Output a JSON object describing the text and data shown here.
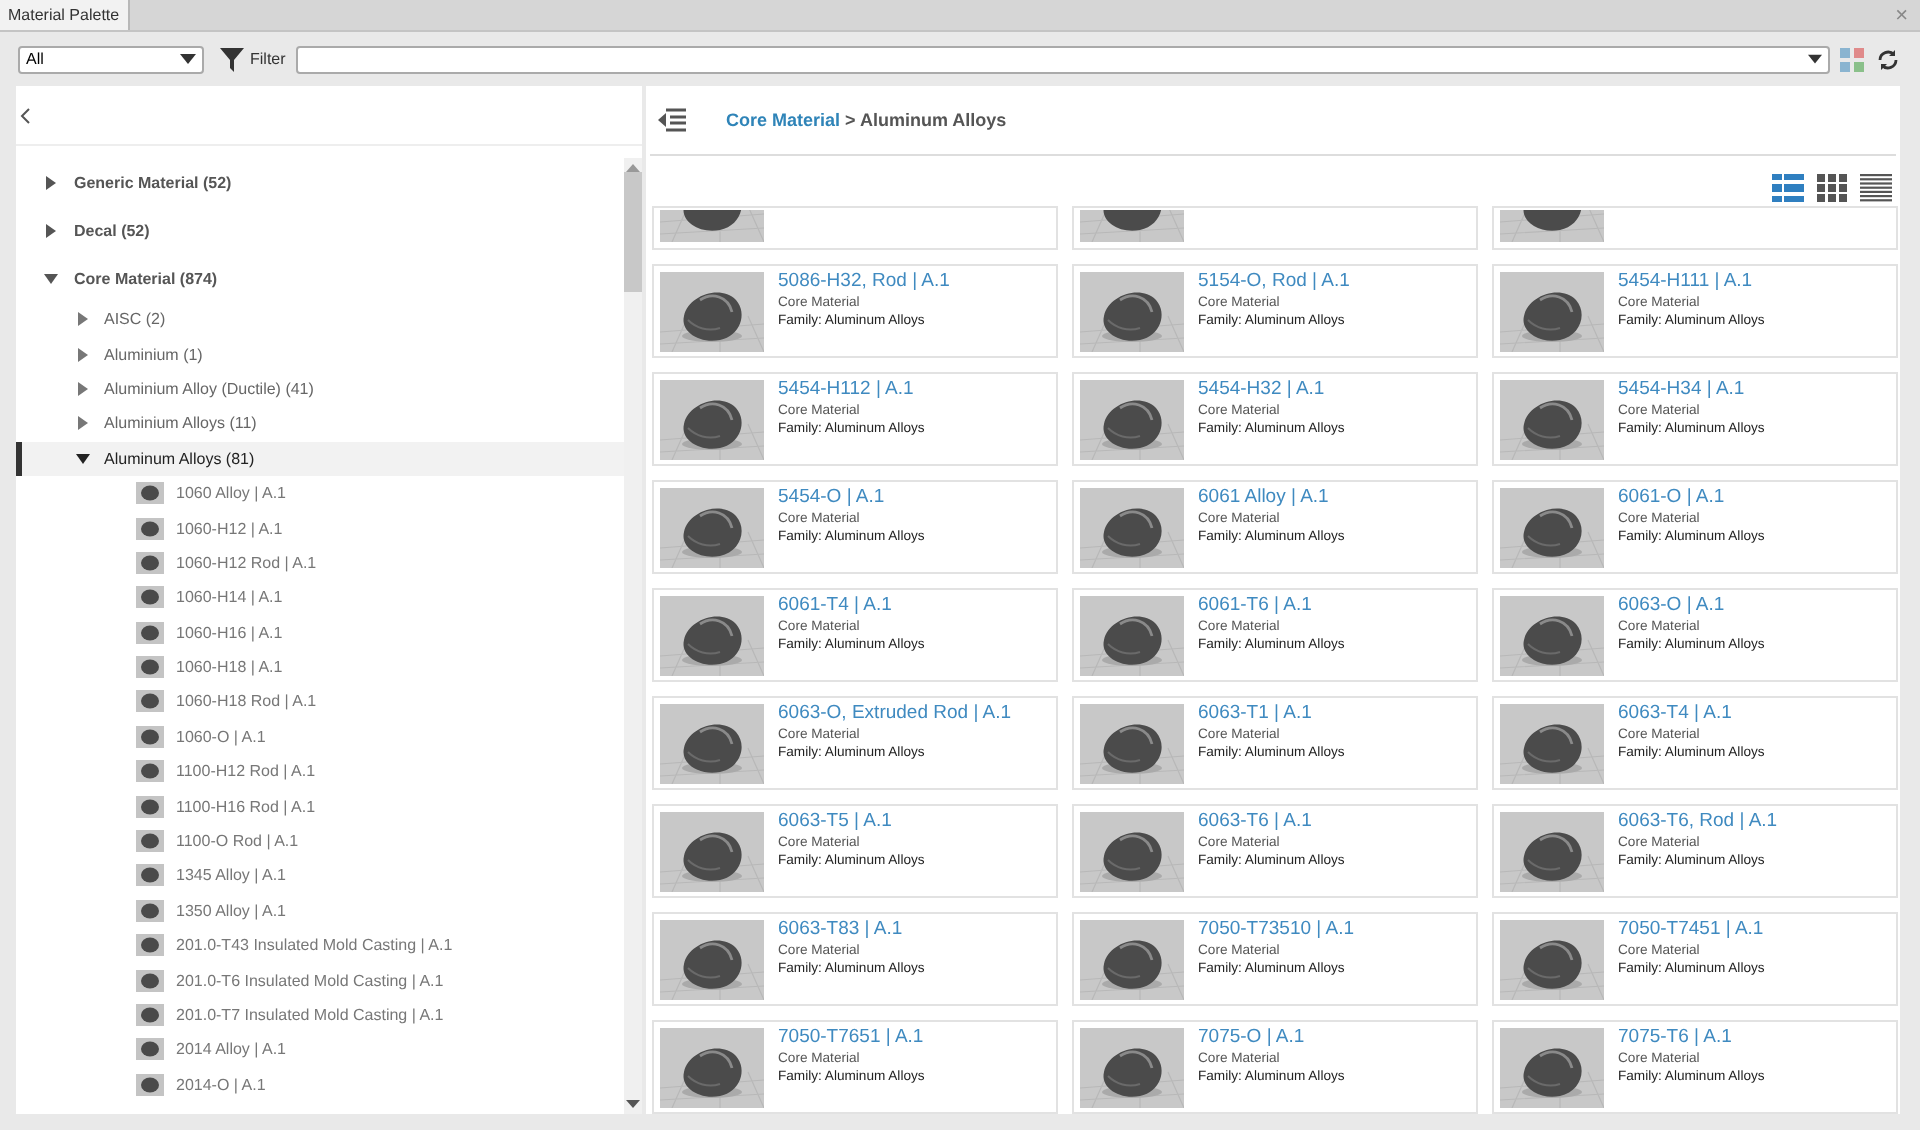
{
  "window": {
    "tab": "Material Palette",
    "close": "×"
  },
  "toolbar": {
    "scope": "All",
    "filter_label": "Filter"
  },
  "tree": [
    {
      "label": "Generic Material  (52)",
      "expanded": false,
      "selected": false
    },
    {
      "label": "Decal  (52)",
      "expanded": false,
      "selected": false
    },
    {
      "label": "Core Material  (874)",
      "expanded": true,
      "selected": false,
      "children": [
        {
          "label": "AISC  (2)",
          "expanded": false,
          "selected": false
        },
        {
          "label": "Aluminium  (1)",
          "expanded": false,
          "selected": false
        },
        {
          "label": "Aluminium Alloy (Ductile)  (41)",
          "expanded": false,
          "selected": false
        },
        {
          "label": "Aluminium Alloys  (11)",
          "expanded": false,
          "selected": false
        },
        {
          "label": "Aluminum Alloys  (81)",
          "expanded": true,
          "selected": true,
          "children": [
            {
              "label": "1060 Alloy | A.1",
              "kind": "material"
            },
            {
              "label": "1060-H12 | A.1",
              "kind": "material"
            },
            {
              "label": "1060-H12 Rod | A.1",
              "kind": "material"
            },
            {
              "label": "1060-H14 | A.1",
              "kind": "material"
            },
            {
              "label": "1060-H16 | A.1",
              "kind": "material"
            },
            {
              "label": "1060-H18 | A.1",
              "kind": "material"
            },
            {
              "label": "1060-H18 Rod | A.1",
              "kind": "material"
            },
            {
              "label": "1060-O | A.1",
              "kind": "material"
            },
            {
              "label": "1100-H12 Rod | A.1",
              "kind": "material"
            },
            {
              "label": "1100-H16 Rod | A.1",
              "kind": "material"
            },
            {
              "label": "1100-O Rod | A.1",
              "kind": "material"
            },
            {
              "label": "1345 Alloy | A.1",
              "kind": "material"
            },
            {
              "label": "1350 Alloy | A.1",
              "kind": "material"
            },
            {
              "label": "201.0-T43 Insulated Mold Casting | A.1",
              "kind": "material"
            },
            {
              "label": "201.0-T6 Insulated Mold Casting | A.1",
              "kind": "material"
            },
            {
              "label": "201.0-T7 Insulated Mold Casting | A.1",
              "kind": "material"
            },
            {
              "label": "2014 Alloy | A.1",
              "kind": "material"
            },
            {
              "label": "2014-O | A.1",
              "kind": "material"
            }
          ]
        }
      ]
    }
  ],
  "breadcrumb": {
    "parent": "Core Material",
    "separator": " > ",
    "current": "Aluminum Alloys"
  },
  "view_modes": [
    {
      "kind": "tiles",
      "selected": true
    },
    {
      "kind": "grid",
      "selected": false
    },
    {
      "kind": "list",
      "selected": false
    }
  ],
  "cards": [
    {
      "title": "5086-H32, Rod | A.1",
      "library": "Core Material",
      "family": "Family: Aluminum Alloys"
    },
    {
      "title": "5154-O, Rod | A.1",
      "library": "Core Material",
      "family": "Family: Aluminum Alloys"
    },
    {
      "title": "5454-H111 | A.1",
      "library": "Core Material",
      "family": "Family: Aluminum Alloys"
    },
    {
      "title": "5454-H112 | A.1",
      "library": "Core Material",
      "family": "Family: Aluminum Alloys"
    },
    {
      "title": "5454-H32 | A.1",
      "library": "Core Material",
      "family": "Family: Aluminum Alloys"
    },
    {
      "title": "5454-H34 | A.1",
      "library": "Core Material",
      "family": "Family: Aluminum Alloys"
    },
    {
      "title": "5454-O | A.1",
      "library": "Core Material",
      "family": "Family: Aluminum Alloys"
    },
    {
      "title": "6061 Alloy | A.1",
      "library": "Core Material",
      "family": "Family: Aluminum Alloys"
    },
    {
      "title": "6061-O | A.1",
      "library": "Core Material",
      "family": "Family: Aluminum Alloys"
    },
    {
      "title": "6061-T4 | A.1",
      "library": "Core Material",
      "family": "Family: Aluminum Alloys"
    },
    {
      "title": "6061-T6 | A.1",
      "library": "Core Material",
      "family": "Family: Aluminum Alloys"
    },
    {
      "title": "6063-O | A.1",
      "library": "Core Material",
      "family": "Family: Aluminum Alloys"
    },
    {
      "title": "6063-O, Extruded Rod | A.1",
      "library": "Core Material",
      "family": "Family: Aluminum Alloys"
    },
    {
      "title": "6063-T1 | A.1",
      "library": "Core Material",
      "family": "Family: Aluminum Alloys"
    },
    {
      "title": "6063-T4 | A.1",
      "library": "Core Material",
      "family": "Family: Aluminum Alloys"
    },
    {
      "title": "6063-T5 | A.1",
      "library": "Core Material",
      "family": "Family: Aluminum Alloys"
    },
    {
      "title": "6063-T6 | A.1",
      "library": "Core Material",
      "family": "Family: Aluminum Alloys"
    },
    {
      "title": "6063-T6, Rod | A.1",
      "library": "Core Material",
      "family": "Family: Aluminum Alloys"
    },
    {
      "title": "6063-T83 | A.1",
      "library": "Core Material",
      "family": "Family: Aluminum Alloys"
    },
    {
      "title": "7050-T73510 | A.1",
      "library": "Core Material",
      "family": "Family: Aluminum Alloys"
    },
    {
      "title": "7050-T7451 | A.1",
      "library": "Core Material",
      "family": "Family: Aluminum Alloys"
    },
    {
      "title": "7050-T7651 | A.1",
      "library": "Core Material",
      "family": "Family: Aluminum Alloys"
    },
    {
      "title": "7075-O | A.1",
      "library": "Core Material",
      "family": "Family: Aluminum Alloys"
    },
    {
      "title": "7075-T6 | A.1",
      "library": "Core Material",
      "family": "Family: Aluminum Alloys"
    }
  ]
}
